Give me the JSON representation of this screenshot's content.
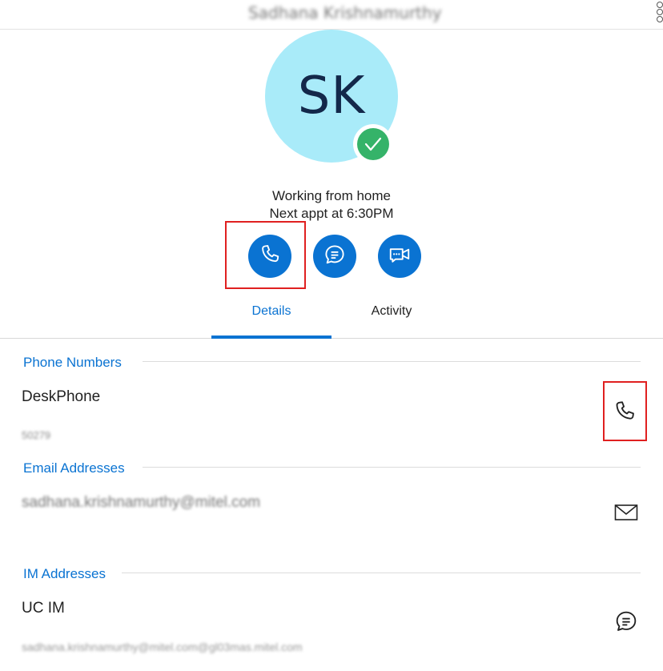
{
  "header": {
    "contact_name": "Sadhana Krishnamurthy"
  },
  "profile": {
    "initials": "SK",
    "presence_status": "available",
    "status_line_1": "Working from home",
    "status_line_2": "Next appt at 6:30PM",
    "colors": {
      "avatar_bg": "#a9ebf9",
      "initials": "#13284a",
      "presence_green": "#35b369",
      "accent_blue": "#0a73d2"
    }
  },
  "actions": [
    {
      "name": "call-button",
      "icon": "phone-icon"
    },
    {
      "name": "chat-button",
      "icon": "chat-bubble-icon"
    },
    {
      "name": "video-button",
      "icon": "video-chat-icon"
    }
  ],
  "tabs": [
    {
      "label": "Details",
      "active": true
    },
    {
      "label": "Activity",
      "active": false
    }
  ],
  "sections": {
    "phone": {
      "title": "Phone Numbers",
      "entry_label": "DeskPhone",
      "entry_value": "50279",
      "action_icon": "phone-icon"
    },
    "email": {
      "title": "Email Addresses",
      "entry_value": "sadhana.krishnamurthy@mitel.com",
      "action_icon": "envelope-icon"
    },
    "im": {
      "title": "IM Addresses",
      "entry_label": "UC IM",
      "entry_value": "sadhana.krishnamurthy@mitel.com@gl03mas.mitel.com",
      "action_icon": "chat-bubble-icon"
    }
  }
}
